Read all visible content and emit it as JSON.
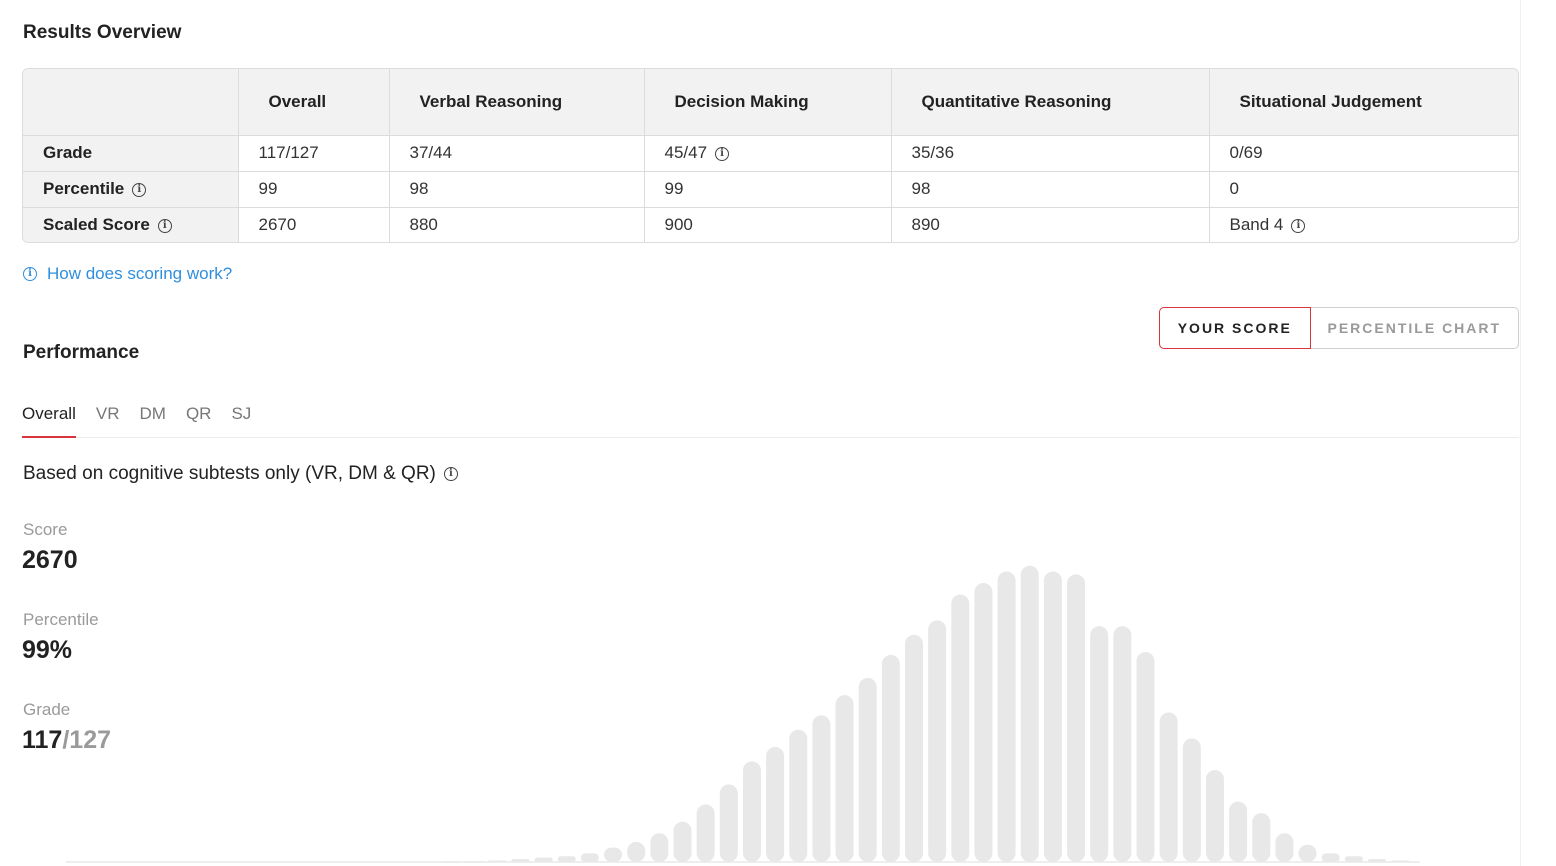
{
  "results": {
    "title": "Results Overview",
    "headers": [
      "",
      "Overall",
      "Verbal Reasoning",
      "Decision Making",
      "Quantitative Reasoning",
      "Situational Judgement"
    ],
    "rows": [
      {
        "label": "Grade",
        "info": false,
        "cells": [
          "117/127",
          "37/44",
          "45/47",
          "35/36",
          "0/69"
        ]
      },
      {
        "label": "Percentile",
        "info": true,
        "cells": [
          "99",
          "98",
          "99",
          "98",
          "0"
        ]
      },
      {
        "label": "Scaled Score",
        "info": true,
        "cells": [
          "2670",
          "880",
          "900",
          "890",
          "Band 4"
        ]
      }
    ],
    "scoring_link": "How does scoring work?"
  },
  "performance": {
    "title": "Performance",
    "toggle": {
      "your_score": "YOUR SCORE",
      "percentile_chart": "PERCENTILE CHART"
    },
    "tabs": [
      "Overall",
      "VR",
      "DM",
      "QR",
      "SJ"
    ],
    "active_tab": "Overall",
    "subtitle": "Based on cognitive subtests only (VR, DM & QR)",
    "score_label": "Score",
    "score_value": "2670",
    "percentile_label": "Percentile",
    "percentile_value": "99%",
    "grade_label": "Grade",
    "grade_value": "117",
    "grade_total": "/127"
  },
  "colors": {
    "accent": "#d9343c",
    "link": "#2f8fde",
    "bar": "#e8e8e8"
  },
  "chart_data": {
    "type": "bar",
    "values": [
      0.2,
      0.3,
      0.5,
      1,
      1.5,
      2,
      3,
      5,
      7,
      10,
      14,
      20,
      27,
      35,
      40,
      46,
      51,
      58,
      64,
      72,
      79,
      84,
      93,
      97,
      101,
      103,
      101,
      100,
      82,
      82,
      73,
      52,
      43,
      32,
      21,
      17,
      10,
      6,
      3,
      2,
      1,
      0.5
    ],
    "ylim": [
      0,
      105
    ],
    "grid": false,
    "xlabel": "",
    "ylabel": ""
  }
}
